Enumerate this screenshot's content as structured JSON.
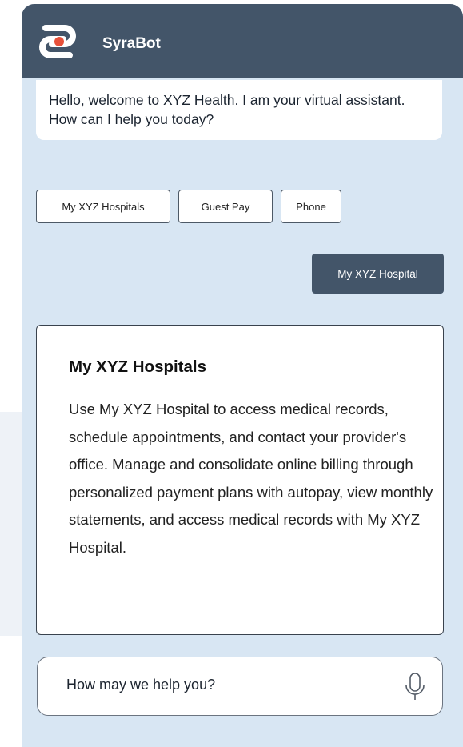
{
  "chat": {
    "bot_name": "SyraBot",
    "welcome_message": "Hello, welcome to XYZ Health. I am your virtual assistant. How can I help you today?",
    "quick_replies": [
      {
        "label": "My XYZ Hospitals"
      },
      {
        "label": "Guest Pay"
      },
      {
        "label": "Phone"
      }
    ],
    "user_message": "My XYZ Hospital",
    "info_card": {
      "title": "My XYZ Hospitals",
      "body": "Use My XYZ Hospital to access medical records, schedule appointments, and contact your provider's office. Manage and consolidate online billing through personalized payment plans with autopay, view monthly statements, and access medical records with My XYZ Hospital."
    },
    "input": {
      "placeholder": "How may we help you?",
      "value": "",
      "mic_icon": "microphone-icon"
    }
  },
  "colors": {
    "header_bg": "#435569",
    "panel_bg": "#d8e6f3",
    "user_bubble_bg": "#435569",
    "logo_dark": "#ffffff",
    "logo_accent": "#e7513a"
  }
}
